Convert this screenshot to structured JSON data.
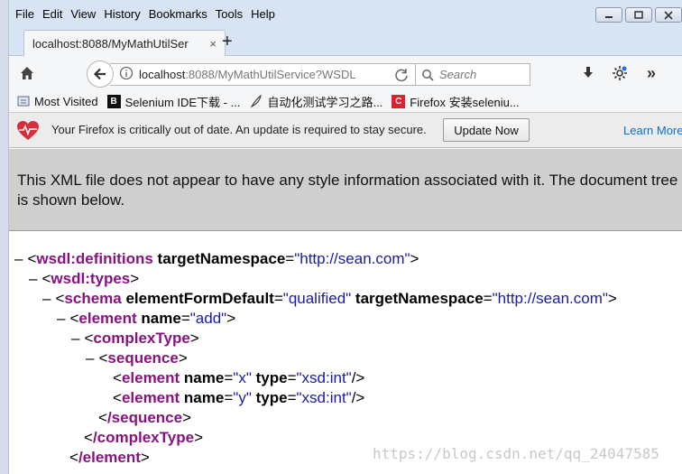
{
  "menu": [
    "File",
    "Edit",
    "View",
    "History",
    "Bookmarks",
    "Tools",
    "Help"
  ],
  "window_controls": [
    "minimize-icon",
    "restore-icon",
    "close-icon"
  ],
  "tab": {
    "title": "localhost:8088/MyMathUtilSer",
    "close": "×",
    "new_tab": "+"
  },
  "navbar": {
    "url_host": "localhost",
    "url_rest": ":8088/MyMathUtilService?WSDL",
    "search_placeholder": "Search",
    "overflow": "»"
  },
  "bookmarks": [
    {
      "label": "Most Visited",
      "icon": "bookmark-folder-icon"
    },
    {
      "label": "Selenium IDE下载 - ...",
      "icon": "B"
    },
    {
      "label": "自动化测试学习之路...",
      "icon": "feather-icon"
    },
    {
      "label": "Firefox 安装seleniu...",
      "icon": "C"
    }
  ],
  "notification": {
    "text": "Your Firefox is critically out of date. An update is required to stay secure.",
    "button": "Update Now",
    "link": "Learn More"
  },
  "xml_info": "This XML file does not appear to have any style information associated with it. The document tree is shown below.",
  "tree": {
    "l1": {
      "tag": "wsdl:definitions",
      "attr": "targetNamespace",
      "val": "\"http://sean.com\""
    },
    "l2": {
      "tag": "wsdl:types"
    },
    "l3": {
      "tag": "schema",
      "attr1": "elementFormDefault",
      "val1": "\"qualified\"",
      "attr2": "targetNamespace",
      "val2": "\"http://sean.com\""
    },
    "l4": {
      "tag": "element",
      "attr": "name",
      "val": "\"add\""
    },
    "l5": {
      "tag": "complexType"
    },
    "l6": {
      "tag": "sequence"
    },
    "l7": {
      "tag": "element",
      "attr1": "name",
      "val1": "\"x\"",
      "attr2": "type",
      "val2": "\"xsd:int\""
    },
    "l8": {
      "tag": "element",
      "attr1": "name",
      "val1": "\"y\"",
      "attr2": "type",
      "val2": "\"xsd:int\""
    },
    "l9": {
      "tag": "/sequence"
    },
    "l10": {
      "tag": "/complexType"
    },
    "l11": {
      "tag": "/element"
    }
  },
  "watermark": "https://blog.csdn.net/qq_24047585",
  "colors": {
    "tag": "#881280",
    "attr_value": "#1a1aa6",
    "link": "#0a6fcf",
    "menubar": "#d8e4f3"
  }
}
